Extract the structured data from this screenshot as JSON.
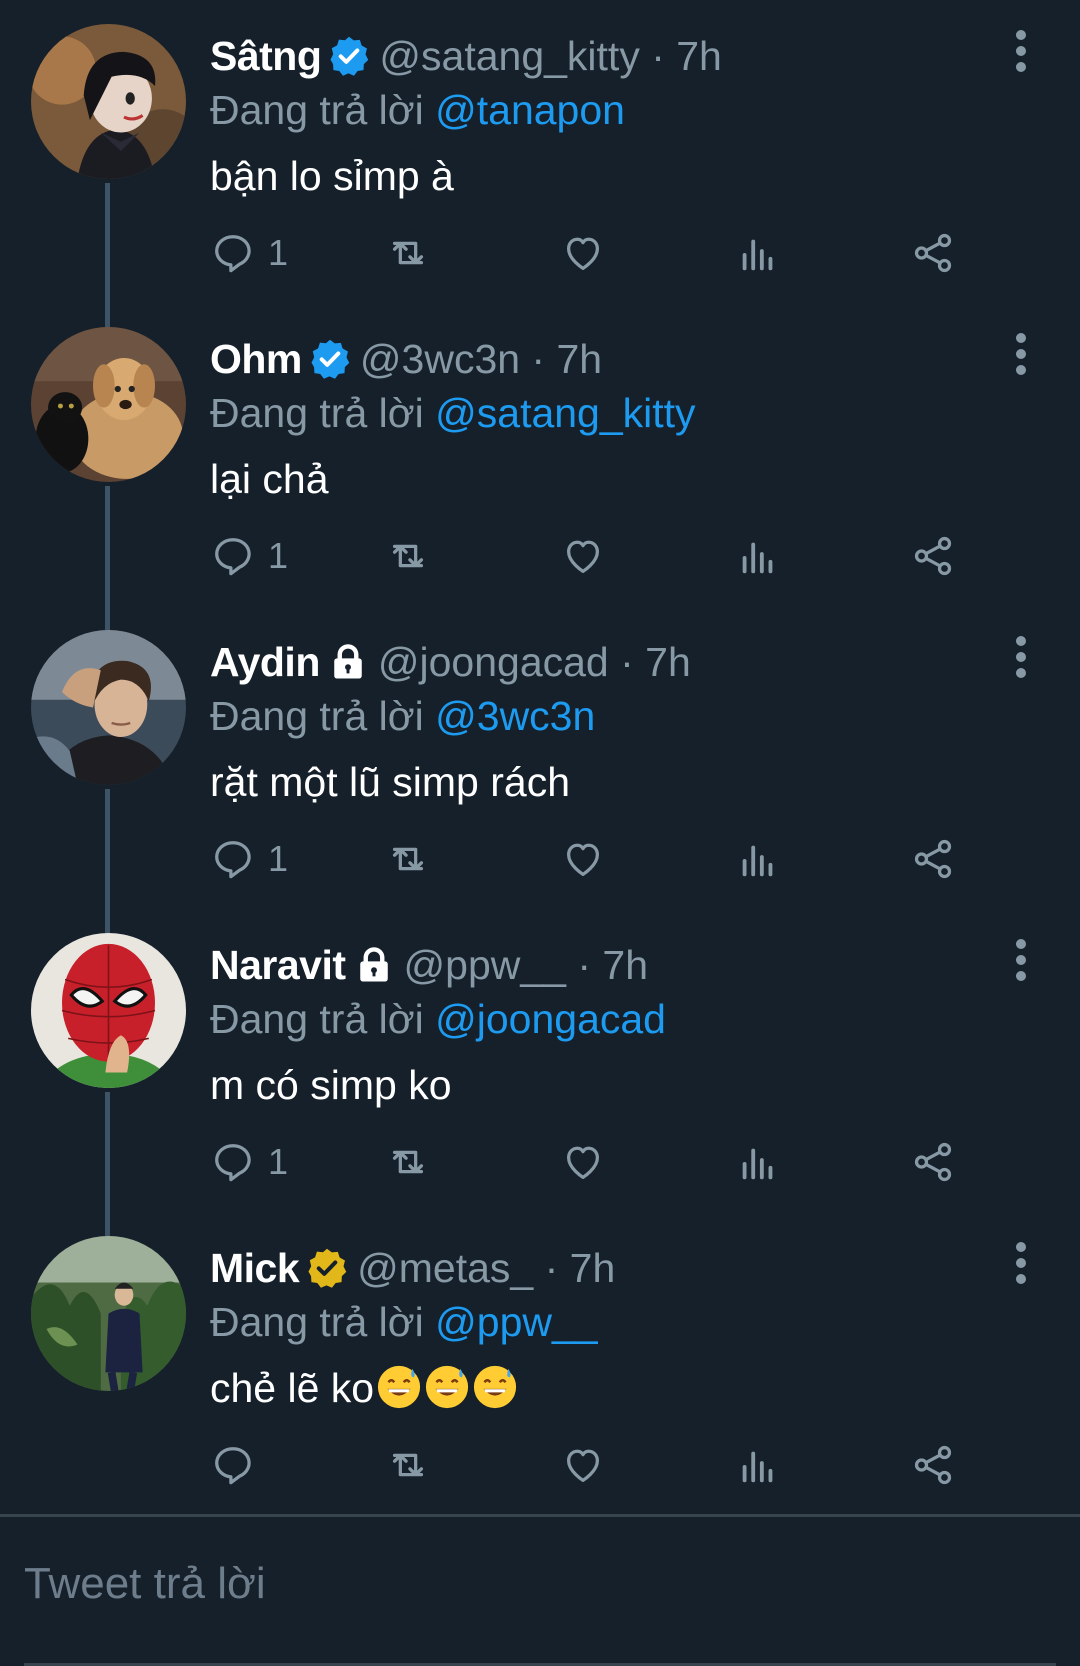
{
  "tweets": [
    {
      "name": "Sâtng",
      "badge": "verified-blue",
      "handle_time": "@satang_kitty · 7h",
      "reply_prefix": "Đang trả lời ",
      "reply_to": "@tanapon",
      "text": "bận lo sỉmp à",
      "reply_count": "1",
      "avatar": "cartoon-girl-avatar"
    },
    {
      "name": "Ohm",
      "badge": "verified-blue",
      "handle_time": "@3wc3n · 7h",
      "reply_prefix": "Đang trả lời ",
      "reply_to": "@satang_kitty",
      "text": "lại chả",
      "reply_count": "1",
      "avatar": "dog-and-cat-avatar"
    },
    {
      "name": "Aydin",
      "badge": "lock",
      "handle_time": "@joongacad · 7h",
      "reply_prefix": "Đang trả lời ",
      "reply_to": "@3wc3n",
      "text": "rặt một lũ simp rách",
      "reply_count": "1",
      "avatar": "boy-portrait-avatar"
    },
    {
      "name": "Naravit",
      "badge": "lock",
      "handle_time": "@ppw__ · 7h",
      "reply_prefix": "Đang trả lời ",
      "reply_to": "@joongacad",
      "text": "m có simp ko",
      "reply_count": "1",
      "avatar": "spiderman-mask-avatar"
    },
    {
      "name": "Mick",
      "badge": "verified-gold",
      "handle_time": "@metas_ · 7h",
      "reply_prefix": "Đang trả lời ",
      "reply_to": "@ppw__",
      "text": "chẻ lẽ ko",
      "emojis": [
        "grinning-sweat-emoji",
        "grinning-sweat-emoji",
        "grinning-sweat-emoji"
      ],
      "reply_count": "",
      "avatar": "forest-portrait-avatar"
    }
  ],
  "compose": {
    "placeholder": "Tweet trả lời"
  },
  "colors": {
    "background": "#15202b",
    "secondary_text": "#8899a6",
    "link": "#1d9bf0",
    "verified_blue": "#1d9bf0",
    "verified_gold": "#e2b719"
  }
}
